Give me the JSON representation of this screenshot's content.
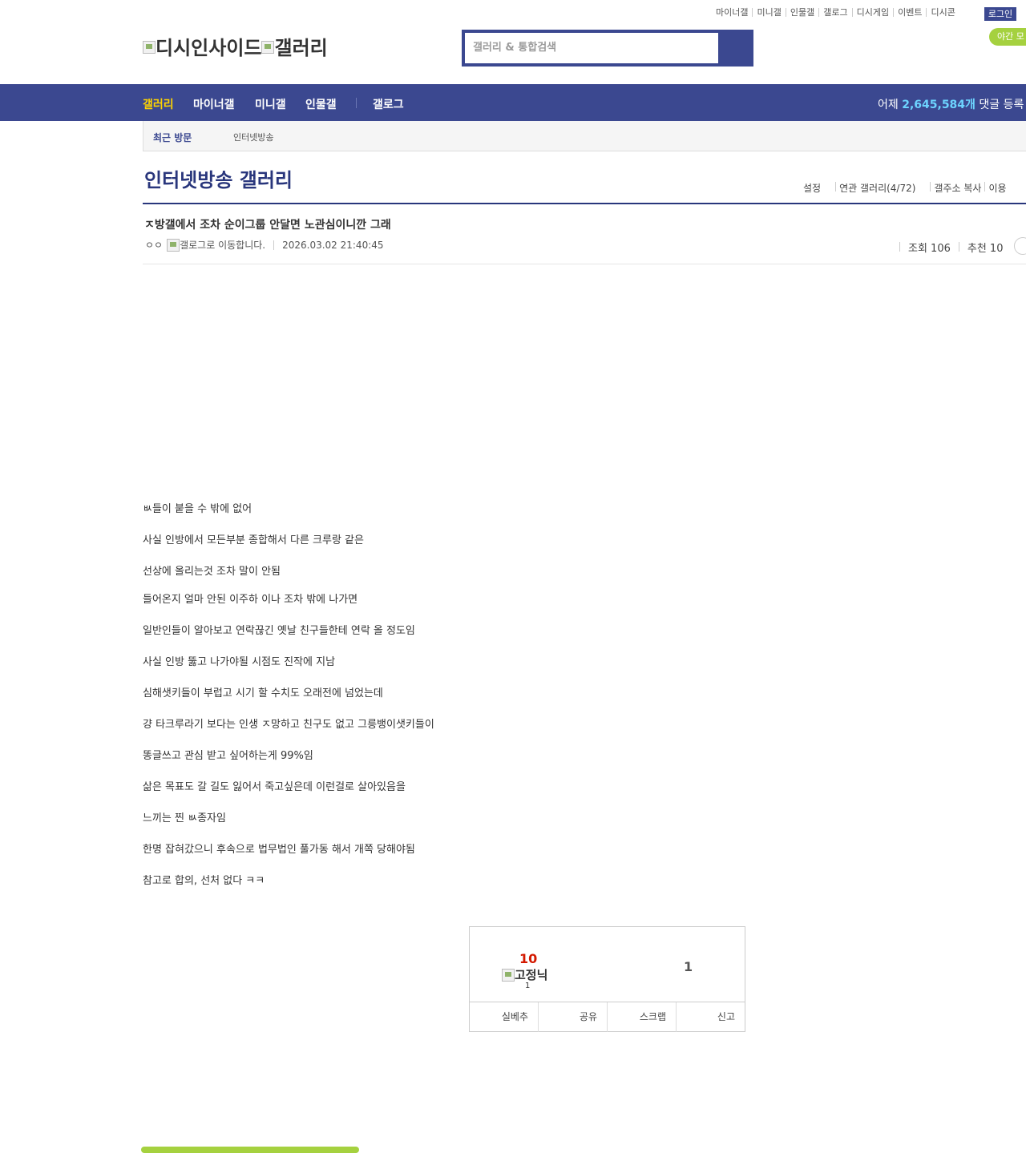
{
  "top_links": [
    "마이너갤",
    "미니갤",
    "인물갤",
    "갤로그",
    "디시게임",
    "이벤트",
    "디시콘"
  ],
  "login": "로그인",
  "night_mode": "야간 모",
  "logo": {
    "part1": "디시인사이드",
    "part2": "갤러리"
  },
  "search": {
    "placeholder": "갤러리 & 통합검색"
  },
  "nav": {
    "items": [
      "갤러리",
      "마이너갤",
      "미니갤",
      "인물갤",
      "갤로그"
    ],
    "stat_prefix": "어제",
    "stat_value": "2,645,584개",
    "stat_suffix": "댓글 등록"
  },
  "recent": {
    "label": "최근 방문",
    "item": "인터넷방송"
  },
  "gallery": {
    "title": "인터넷방송 갤러리",
    "menu": [
      "설정",
      "연관 갤러리(4/72)",
      "갤주소 복사",
      "이용"
    ]
  },
  "post": {
    "title": "ㅈ방갤에서 조차 순이그룹 안달면 노관심이니깐 그래",
    "author": "ㅇㅇ",
    "gallog_img_alt": "갤로그로 이동합니다.",
    "date": "2026.03.02 21:40:45",
    "views_label": "조회 106",
    "recommend_label": "추천 10",
    "lines": [
      "ㅄ들이 붙을 수 밖에 없어",
      "사실 인방에서 모든부분 종합해서 다른 크루랑 같은",
      "선상에 올리는것 조차 말이 안됨",
      "들어온지 얼마 안된 이주하 이나 조차 밖에 나가면",
      "일반인들이 알아보고 연락끊긴 옛날 친구들한테 연락 올 정도임",
      "사실 인방 뚫고 나가야될 시점도 진작에 지남",
      "심해샛키들이 부럽고 시기 할 수치도 오래전에 넘었는데",
      "걍 타크루라기 보다는 인생 ㅈ망하고 친구도 없고 그릉뱅이샛키들이",
      "똥글쓰고 관심 받고 싶어하는게 99%임",
      "삶은 목표도 갈 길도 잃어서 죽고싶은데 이런걸로 살아있음을",
      "느끼는 찐 ㅄ종자임",
      "한명 잡혀갔으니 후속으로 법무법인 풀가동 해서 개쪽 당해야됨",
      "참고로 합의, 선처 없다 ㅋㅋ"
    ]
  },
  "recommend_box": {
    "up_count": "10",
    "fixed_nick_alt": "고정닉",
    "fixed_nick_count": "1",
    "down_count": "1",
    "actions": [
      "실베추",
      "공유",
      "스크랩",
      "신고"
    ]
  }
}
